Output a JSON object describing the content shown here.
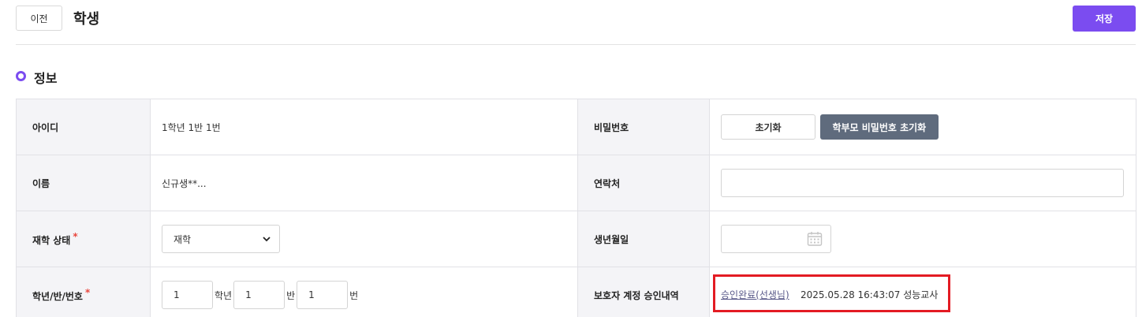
{
  "header": {
    "back_label": "이전",
    "title": "학생",
    "save_label": "저장"
  },
  "section": {
    "title": "정보"
  },
  "rows": {
    "id_label": "아이디",
    "id_value": "1학년 1반 1번",
    "password_label": "비밀번호",
    "reset_label": "초기화",
    "parent_reset_label": "학부모 비밀번호 초기화",
    "name_label": "이름",
    "name_value": "신규생**...",
    "contact_label": "연락처",
    "contact_value": "",
    "status_label": "재학 상태",
    "status_value": "재학",
    "birthdate_label": "생년월일",
    "birthdate_value": "",
    "class_label": "학년/반/번호",
    "grade_value": "1",
    "grade_unit": "학년",
    "class_value": "1",
    "class_unit": "반",
    "number_value": "1",
    "number_unit": "번",
    "guardian_label": "보호자 계정 승인내역",
    "approval_link": "승인완료(선생님)",
    "approval_info": "2025.05.28 16:43:07 성능교사",
    "required_mark": "*"
  },
  "colors": {
    "accent": "#7b4cf0",
    "required": "#e8483f",
    "highlight": "#e31b23",
    "dark_button": "#5f6b7d"
  }
}
